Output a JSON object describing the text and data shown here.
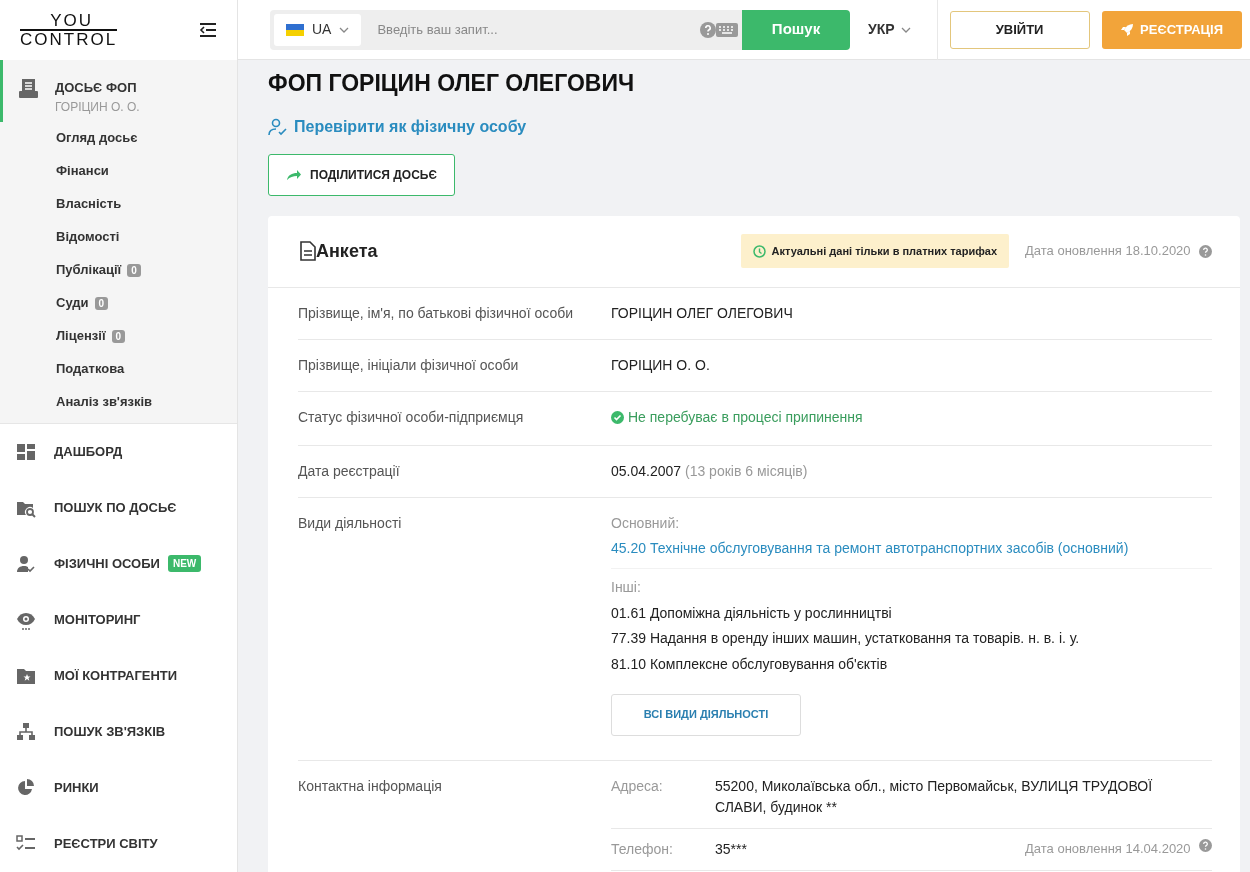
{
  "logo": {
    "top": "YOU",
    "bottom": "CONTROL"
  },
  "header": {
    "country": "UA",
    "search_placeholder": "Введіть ваш запит...",
    "search_button": "Пошук",
    "language": "УКР",
    "login": "УВІЙТИ",
    "register": "РЕЄСТРАЦІЯ"
  },
  "sidebar": {
    "dossier": {
      "title": "ДОСЬЄ ФОП",
      "subtitle": "ГОРІЦИН О. О.",
      "selected": true
    },
    "sections": [
      {
        "label": "Огляд досьє"
      },
      {
        "label": "Фінанси"
      },
      {
        "label": "Власність"
      },
      {
        "label": "Відомості"
      },
      {
        "label": "Публікації",
        "badge": "0"
      },
      {
        "label": "Суди",
        "badge": "0"
      },
      {
        "label": "Ліцензії",
        "badge": "0"
      },
      {
        "label": "Податкова"
      },
      {
        "label": "Аналіз зв'язків"
      }
    ],
    "nav": [
      {
        "label": "ДАШБОРД"
      },
      {
        "label": "ПОШУК ПО ДОСЬЄ"
      },
      {
        "label": "ФІЗИЧНІ ОСОБИ",
        "badge": "NEW"
      },
      {
        "label": "МОНІТОРИНГ"
      },
      {
        "label": "МОЇ КОНТРАГЕНТИ"
      },
      {
        "label": "ПОШУК ЗВ'ЯЗКІВ"
      },
      {
        "label": "РИНКИ"
      },
      {
        "label": "РЕЄСТРИ СВІТУ"
      }
    ]
  },
  "page": {
    "title": "ФОП ГОРІЦИН ОЛЕГ ОЛЕГОВИЧ",
    "check_link": "Перевірити як фізичну особу",
    "share_button": "ПОДІЛИТИСЯ ДОСЬЄ"
  },
  "card": {
    "title": "Анкета",
    "notice": "Актуальні дані тільки в платних тарифах",
    "updated": "Дата оновлення 18.10.2020",
    "rows": [
      {
        "kind": "text",
        "label": "Прізвище, ім'я, по батькові фізичної особи",
        "value": "ГОРІЦИН ОЛЕГ ОЛЕГОВИЧ"
      },
      {
        "kind": "text",
        "label": "Прізвище, ініціали фізичної особи",
        "value": "ГОРІЦИН О. О."
      },
      {
        "kind": "status",
        "label": "Статус фізичної особи-підприємця",
        "value": "Не перебуває в процесі припинення"
      },
      {
        "kind": "date",
        "label": "Дата реєстрації",
        "value": "05.04.2007",
        "note": "(13 років 6 місяців)"
      },
      {
        "kind": "activities",
        "label": "Види діяльності",
        "main_label": "Основний:",
        "main": "45.20 Технічне обслуговування та ремонт автотранспортних засобів (основний)",
        "other_label": "Інші:",
        "others": [
          "01.61 Допоміжна діяльність у рослинництві",
          "77.39 Надання в оренду інших машин, устатковання та товарів. н. в. і. у.",
          "81.10 Комплексне обслуговування об'єктів"
        ],
        "button": "ВСІ ВИДИ ДІЯЛЬНОСТІ"
      },
      {
        "kind": "contacts",
        "label": "Контактна інформація",
        "items": [
          {
            "label": "Адреса:",
            "value": "55200, Миколаївська обл., місто Первомайськ, ВУЛИЦЯ ТРУДОВОЇ СЛАВИ, будинок **"
          },
          {
            "label": "Телефон:",
            "value": "35***",
            "updated": "Дата оновлення 14.04.2020"
          }
        ]
      }
    ]
  }
}
